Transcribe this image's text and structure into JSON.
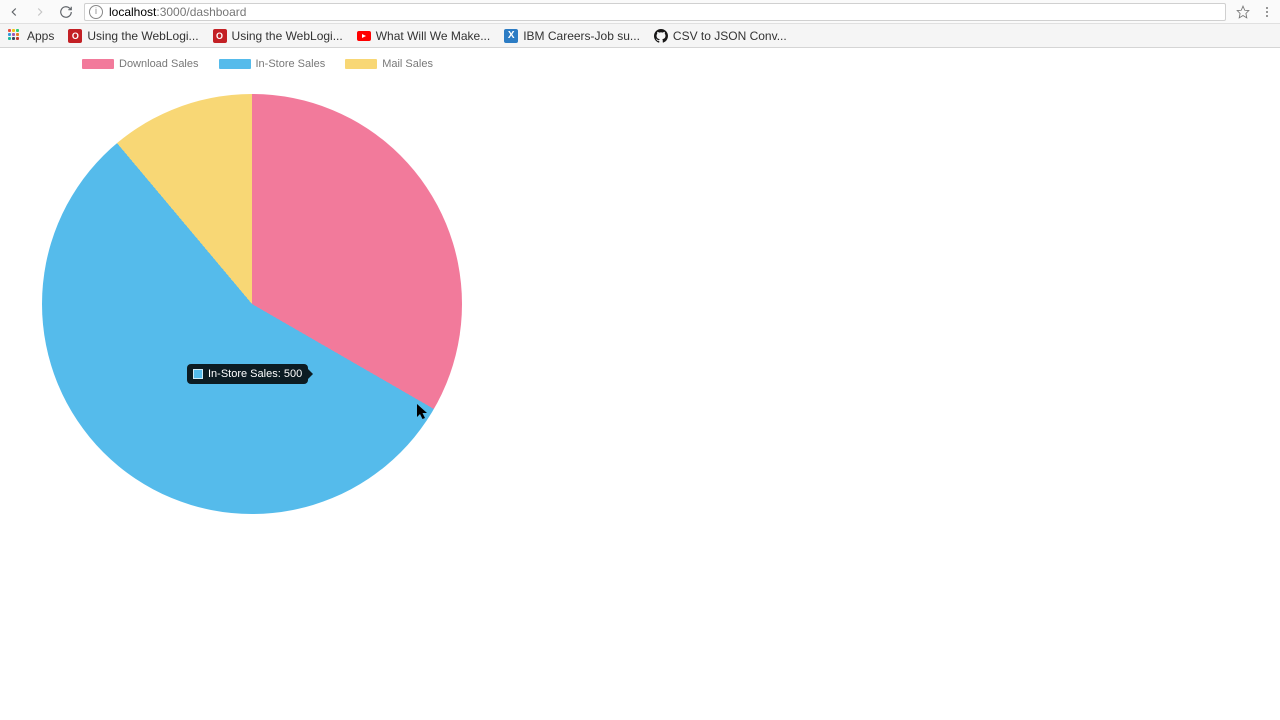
{
  "browser": {
    "url_host": "localhost",
    "url_port_path": ":3000/dashboard",
    "apps_label": "Apps",
    "bookmarks": [
      {
        "icon": "oracle",
        "label": "Using the WebLogi..."
      },
      {
        "icon": "oracle",
        "label": "Using the WebLogi..."
      },
      {
        "icon": "youtube",
        "label": "What Will We Make..."
      },
      {
        "icon": "x",
        "label": "IBM Careers-Job su..."
      },
      {
        "icon": "github",
        "label": "CSV to JSON Conv..."
      }
    ]
  },
  "chart_data": {
    "type": "pie",
    "series": [
      {
        "name": "Download Sales",
        "value": 300,
        "color": "#f27a9b"
      },
      {
        "name": "In-Store Sales",
        "value": 500,
        "color": "#55bbeb"
      },
      {
        "name": "Mail Sales",
        "value": 100,
        "color": "#f8d775"
      }
    ]
  },
  "tooltip": {
    "label": "In-Store Sales",
    "value": 500,
    "color": "#55bbeb"
  }
}
